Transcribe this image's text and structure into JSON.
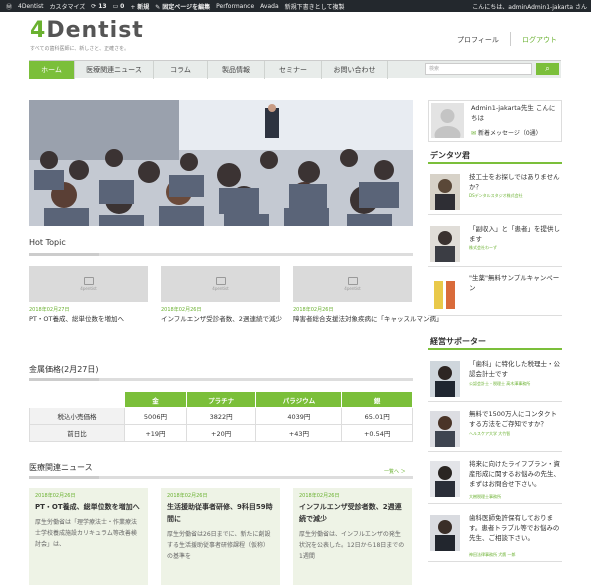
{
  "adminbar": {
    "site": "4Dentist",
    "customize": "カスタマイズ",
    "updates": "13",
    "comments": "0",
    "new": "新規",
    "edit": "固定ページを編集",
    "perf": "Performance",
    "avada": "Avada",
    "draft": "新規下書きとして複製",
    "greeting": "こんにちは、adminAdmin1-jakarta さん"
  },
  "header": {
    "logo_a": "4",
    "logo_b": "Dentist",
    "tagline": "すべての歯科医師に、新しさと、正確さを。",
    "profile": "プロフィール",
    "logout": "ログアウト"
  },
  "nav": [
    "ホーム",
    "医療関連ニュース",
    "コラム",
    "製品情報",
    "セミナー",
    "お問い合わせ"
  ],
  "search": {
    "placeholder": "検索",
    "icon": "search-icon"
  },
  "hot_topic": {
    "title": "Hot Topic",
    "no_image": "4pentist",
    "items": [
      {
        "date": "2018年02月27日",
        "title": "PT・OT養成、総単位数を増加へ"
      },
      {
        "date": "2018年02月26日",
        "title": "インフルエンザ受診者数、2週連続で減少"
      },
      {
        "date": "2018年02月26日",
        "title": "障害者総合支援法対象疾病に「キャッスルマン病」"
      }
    ]
  },
  "metal": {
    "title": "金属価格(2月27日)",
    "headers": [
      "",
      "金",
      "プラチナ",
      "パラジウム",
      "銀"
    ],
    "rows": [
      [
        "税込小売価格",
        "5006円",
        "3822円",
        "4039円",
        "65.01円"
      ],
      [
        "前日比",
        "+19円",
        "+20円",
        "+43円",
        "+0.54円"
      ]
    ]
  },
  "news": {
    "title": "医療関連ニュース",
    "more": "一覧へ ＞",
    "items": [
      {
        "date": "2018年02月26日",
        "title": "PT・OT養成、総単位数を増加へ",
        "body": "厚生労働省は「理学療法士・作業療法士学校養成施設カリキュラム等改善検討会」は、"
      },
      {
        "date": "2018年02月26日",
        "title": "生活援助従事者研修、9科目59時間に",
        "body": "厚生労働省は26日までに、新たに創設する生活援助従事者研修課程（仮称）の基準を"
      },
      {
        "date": "2018年02月26日",
        "title": "インフルエンザ受診者数、2週連続で減少",
        "body": "厚生労働省は、インフルエンザの発生状況を公表した。12日から18日までの1週間"
      }
    ]
  },
  "sidebar": {
    "user": "Admin1-jakarta先生 こんにちは",
    "messages": "新着メッセージ（0通）",
    "dentsu_title": "デンタツ君",
    "dentsu": [
      {
        "title": "技工士をお探しではありませんか？",
        "sub": "DSデンタルスタジオ株式会社"
      },
      {
        "title": "「副収入」と「患者」を提供します",
        "sub": "株式会社わーず"
      },
      {
        "title": "\"生薬\"無料サンプルキャンペーン",
        "sub": ""
      }
    ],
    "supporter_title": "経営サポーター",
    "supporters": [
      {
        "title": "「歯科」に特化した税理士・公認会計士です",
        "sub": "公認会計士・税理士 高木澤事務所"
      },
      {
        "title": "無料で1500万人にコンタクトする方法をご存知ですか？",
        "sub": "ヘルスケア大学 大竹智"
      },
      {
        "title": "将来に向けたライフプラン・資産形成に関するお悩みの先生、まずはお問合せ下さい。",
        "sub": "大樹税理士事務所"
      },
      {
        "title": "歯科医師免許保有しております。患者トラブル等でお悩みの先生、ご相談下さい。",
        "sub": "神田法律事務所 犬鷹 一郎"
      }
    ]
  }
}
